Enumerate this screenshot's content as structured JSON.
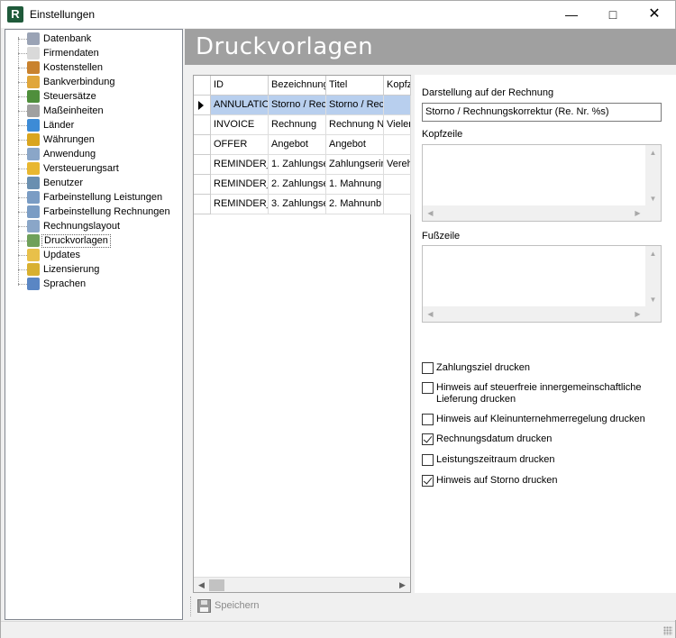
{
  "window": {
    "title": "Einstellungen",
    "app_icon": "R"
  },
  "sidebar": {
    "items": [
      {
        "label": "Datenbank",
        "icon": "database-icon",
        "color": "#9aa3b5"
      },
      {
        "label": "Firmendaten",
        "icon": "document-icon",
        "color": "#d9d9d9"
      },
      {
        "label": "Kostenstellen",
        "icon": "house-icon",
        "color": "#c9822e"
      },
      {
        "label": "Bankverbindung",
        "icon": "euro-icon",
        "color": "#e0a63a"
      },
      {
        "label": "Steuersätze",
        "icon": "pie-chart-icon",
        "color": "#4f8f3c"
      },
      {
        "label": "Maßeinheiten",
        "icon": "ruler-icon",
        "color": "#a0a0a0"
      },
      {
        "label": "Länder",
        "icon": "globe-icon",
        "color": "#3d8bd6"
      },
      {
        "label": "Währungen",
        "icon": "coins-icon",
        "color": "#d9a520"
      },
      {
        "label": "Anwendung",
        "icon": "window-icon",
        "color": "#8aa6c8"
      },
      {
        "label": "Versteuerungsart",
        "icon": "blocks-icon",
        "color": "#e8b730"
      },
      {
        "label": "Benutzer",
        "icon": "user-icon",
        "color": "#6a8fb0"
      },
      {
        "label": "Farbeinstellung Leistungen",
        "icon": "color-grid-icon",
        "color": "#7a9cc4"
      },
      {
        "label": "Farbeinstellung Rechnungen",
        "icon": "color-grid-icon",
        "color": "#7a9cc4"
      },
      {
        "label": "Rechnungslayout",
        "icon": "layout-icon",
        "color": "#8aa6c8"
      },
      {
        "label": "Druckvorlagen",
        "icon": "template-icon",
        "color": "#6fa05a",
        "selected": true
      },
      {
        "label": "Updates",
        "icon": "folder-icon",
        "color": "#e8c04a"
      },
      {
        "label": "Lizensierung",
        "icon": "key-icon",
        "color": "#d8b030"
      },
      {
        "label": "Sprachen",
        "icon": "speech-icon",
        "color": "#5a86c4"
      }
    ]
  },
  "header": {
    "title": "Druckvorlagen"
  },
  "grid": {
    "columns": [
      "ID",
      "Bezeichnung",
      "Titel",
      "Kopfz"
    ],
    "rows": [
      [
        "ANNULATIO",
        "Storno / Rec",
        "Storno / Rec",
        ""
      ],
      [
        "INVOICE",
        "Rechnung",
        "Rechnung N",
        "Vielen"
      ],
      [
        "OFFER",
        "Angebot",
        "Angebot",
        ""
      ],
      [
        "REMINDER_",
        "1. Zahlungse",
        "Zahlungserin",
        "Vereh"
      ],
      [
        "REMINDER_",
        "2. Zahlungse",
        "1. Mahnung",
        ""
      ],
      [
        "REMINDER_",
        "3. Zahlungse",
        "2. Mahnunb",
        ""
      ]
    ],
    "selected_row": 0
  },
  "form": {
    "darstellung_label": "Darstellung auf der Rechnung",
    "darstellung_value": "Storno / Rechnungskorrektur (Re. Nr. %s)",
    "kopfzeile_label": "Kopfzeile",
    "fusszeile_label": "Fußzeile",
    "checkboxes": [
      {
        "label": "Zahlungsziel drucken",
        "checked": false
      },
      {
        "label": "Hinweis auf steuerfreie innergemeinschaftliche Lieferung drucken",
        "checked": false
      },
      {
        "label": "Hinweis auf Kleinunternehmerregelung drucken",
        "checked": false
      },
      {
        "label": "Rechnungsdatum drucken",
        "checked": true
      },
      {
        "label": "Leistungszeitraum drucken",
        "checked": false
      },
      {
        "label": "Hinweis auf Storno drucken",
        "checked": true
      }
    ]
  },
  "toolbar": {
    "save_label": "Speichern"
  }
}
